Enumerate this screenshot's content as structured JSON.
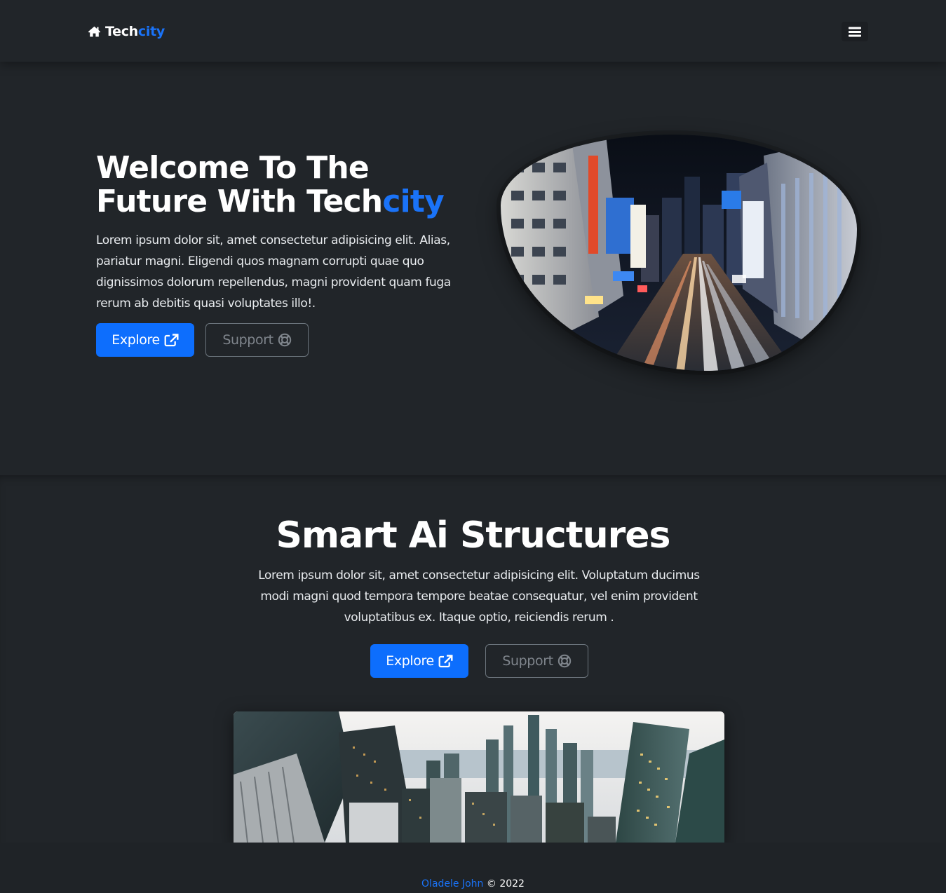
{
  "navbar": {
    "brand_main": "Tech",
    "brand_accent": "city",
    "brand_icon": "home-icon",
    "menu_icon": "hamburger-menu-icon"
  },
  "hero": {
    "title_line1": "Welcome To The",
    "title_line2_main": "Future With Tech",
    "title_line2_accent": "city",
    "description": "Lorem ipsum dolor sit, amet consectetur adipisicing elit. Alias, pariatur magni. Eligendi quos magnam corrupti quae quo dignissimos dolorum repellendus, magni provident quam fuga rerum ab debitis quasi voluptates illo!.",
    "explore_label": "Explore",
    "explore_icon": "external-link-icon",
    "support_label": "Support",
    "support_icon": "life-ring-icon"
  },
  "section2": {
    "title": "Smart Ai Structures",
    "description": "Lorem ipsum dolor sit, amet consectetur adipisicing elit. Voluptatum ducimus modi magni quod tempora tempore beatae consequatur, vel enim provident voluptatibus ex. Itaque optio, reiciendis rerum .",
    "explore_label": "Explore",
    "support_label": "Support"
  },
  "footer": {
    "author": "Oladele John",
    "copyright": "© 2022"
  },
  "colors": {
    "background": "#212529",
    "accent": "#1a73f8",
    "primary_button": "#0d6efd",
    "outline_button": "#6c757d"
  }
}
